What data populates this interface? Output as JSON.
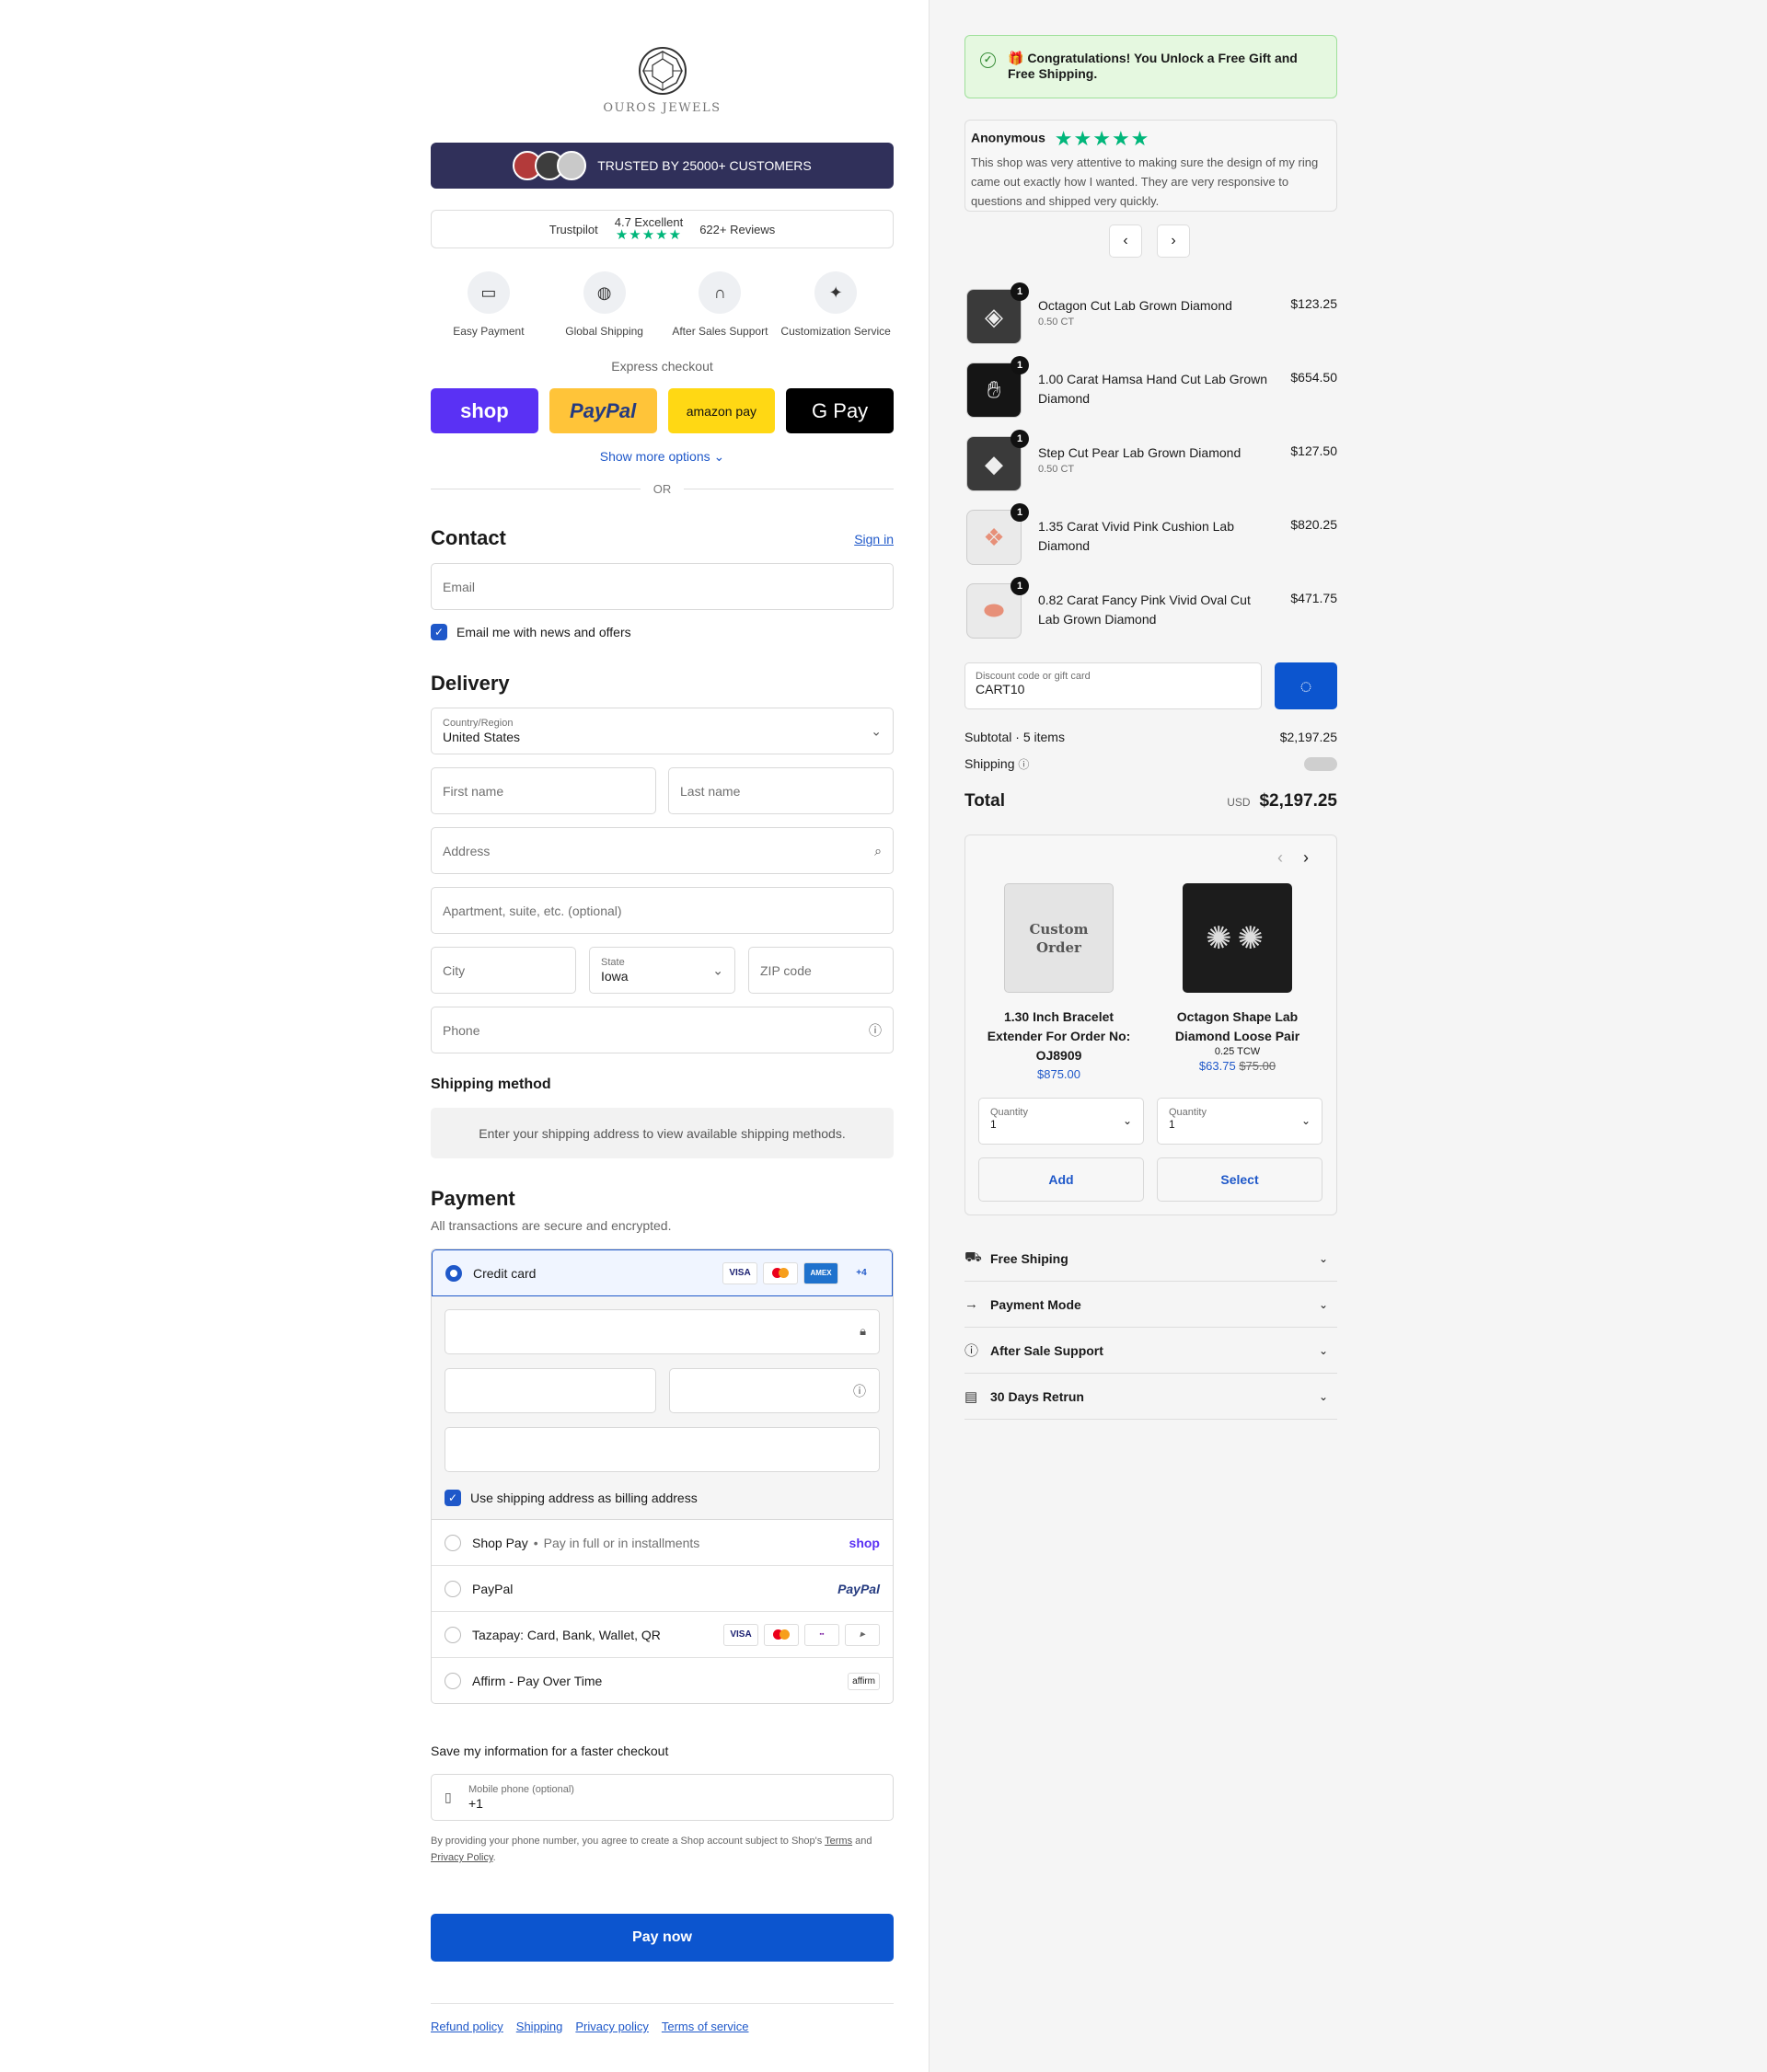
{
  "brand": {
    "logo_text": "OUROS JEWELS"
  },
  "trusted": {
    "label": "TRUSTED BY 25000+ CUSTOMERS"
  },
  "trustpilot": {
    "brand": "Trustpilot",
    "rating": "4.7 Excellent",
    "stars": "★★★★★",
    "reviews": "622+ Reviews"
  },
  "features": [
    {
      "icon": "card-icon",
      "label": "Easy Payment"
    },
    {
      "icon": "globe-icon",
      "label": "Global Shipping"
    },
    {
      "icon": "headset-icon",
      "label": "After Sales Support"
    },
    {
      "icon": "sparkle-icon",
      "label": "Customization Service"
    }
  ],
  "express": {
    "label": "Express checkout",
    "shop": "shop",
    "paypal": "PayPal",
    "amazon": "amazon pay",
    "gpay": "G Pay",
    "show_more": "Show more options",
    "or": "OR"
  },
  "contact": {
    "title": "Contact",
    "sign_in": "Sign in",
    "email_placeholder": "Email",
    "newsletter": "Email me with news and offers"
  },
  "delivery": {
    "title": "Delivery",
    "country_label": "Country/Region",
    "country_value": "United States",
    "first_name": "First name",
    "last_name": "Last name",
    "address": "Address",
    "apartment": "Apartment, suite, etc. (optional)",
    "city": "City",
    "state_label": "State",
    "state_value": "Iowa",
    "zip": "ZIP code",
    "phone": "Phone"
  },
  "shipping_method": {
    "title": "Shipping method",
    "message": "Enter your shipping address to view available shipping methods."
  },
  "payment": {
    "title": "Payment",
    "subtitle": "All transactions are secure and encrypted.",
    "credit_card": "Credit card",
    "cards": [
      "VISA",
      "MC",
      "AMEX",
      "+4"
    ],
    "billing": "Use shipping address as billing address",
    "shop_pay": "Shop Pay",
    "shop_pay_sub": "Pay in full or in installments",
    "shop_pay_brand": "shop",
    "paypal": "PayPal",
    "paypal_brand": "PayPal",
    "tazapay": "Tazapay: Card, Bank, Wallet, QR",
    "affirm": "Affirm - Pay Over Time",
    "affirm_brand": "affirm"
  },
  "save": {
    "title": "Save my information for a faster checkout",
    "mobile_label": "Mobile phone (optional)",
    "mobile_value": "+1",
    "legal_1": "By providing your phone number, you agree to create a Shop account subject to Shop's",
    "legal_terms": "Terms",
    "legal_and": "and",
    "legal_privacy": "Privacy Policy",
    "legal_end": "."
  },
  "pay_now": "Pay now",
  "footer": [
    "Refund policy",
    "Shipping",
    "Privacy policy",
    "Terms of service"
  ],
  "congrats": "🎁 Congratulations! You Unlock a Free Gift and Free Shipping.",
  "review": {
    "author": "Anonymous",
    "stars": "★★★★★",
    "text": "This shop was very attentive to making sure the design of my ring came out exactly how I wanted. They are very responsive to questions and shipped very quickly."
  },
  "cart_items": [
    {
      "name": "Octagon Cut Lab Grown Diamond",
      "variant": "0.50 CT",
      "price": "$123.25",
      "qty": "1"
    },
    {
      "name": "1.00 Carat Hamsa Hand Cut Lab Grown Diamond",
      "variant": "",
      "price": "$654.50",
      "qty": "1"
    },
    {
      "name": "Step Cut Pear Lab Grown Diamond",
      "variant": "0.50 CT",
      "price": "$127.50",
      "qty": "1"
    },
    {
      "name": "1.35 Carat Vivid Pink Cushion Lab Diamond",
      "variant": "",
      "price": "$820.25",
      "qty": "1"
    },
    {
      "name": "0.82 Carat Fancy Pink Vivid Oval Cut Lab Grown Diamond",
      "variant": "",
      "price": "$471.75",
      "qty": "1"
    }
  ],
  "discount": {
    "label": "Discount code or gift card",
    "value": "CART10"
  },
  "summary": {
    "subtotal_label": "Subtotal · 5 items",
    "subtotal": "$2,197.25",
    "shipping_label": "Shipping",
    "total_label": "Total",
    "currency": "USD",
    "total": "$2,197.25"
  },
  "upsell": [
    {
      "name": "1.30 Inch Bracelet Extender For Order No: OJ8909",
      "variant": "",
      "price": "$875.00",
      "compare": "",
      "qty_label": "Quantity",
      "qty": "1",
      "button": "Add",
      "image_text": "Custom Order"
    },
    {
      "name": "Octagon Shape Lab Diamond Loose Pair",
      "variant": "0.25 TCW",
      "price": "$63.75",
      "compare": "$75.00",
      "qty_label": "Quantity",
      "qty": "1",
      "button": "Select",
      "image_text": ""
    }
  ],
  "accordion": [
    {
      "icon": "truck-icon",
      "label": "Free Shiping"
    },
    {
      "icon": "arrow-right-icon",
      "label": "Payment Mode"
    },
    {
      "icon": "help-icon",
      "label": "After Sale Support"
    },
    {
      "icon": "return-box-icon",
      "label": "30 Days Retrun"
    }
  ],
  "colors": {
    "accent": "#0c55cf",
    "trusted_bg": "#30305a",
    "trustpilot_green": "#00b67a",
    "congrats_bg": "#e5f8e0"
  }
}
